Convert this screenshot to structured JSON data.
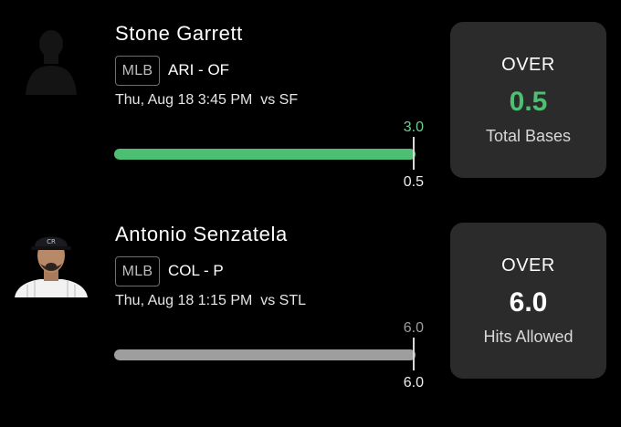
{
  "picks": [
    {
      "player_name": "Stone Garrett",
      "league": "MLB",
      "team_position": "ARI - OF",
      "game_time": "Thu, Aug 18 3:45 PM  vs SF",
      "actual_value": "3.0",
      "line_value": "0.5",
      "progress_fraction": 1.0,
      "bar_color": "#4cbf72",
      "avatar_icon": "player-silhouette-icon",
      "card": {
        "direction": "OVER",
        "value": "0.5",
        "stat": "Total Bases",
        "value_color": "#4cbf72"
      }
    },
    {
      "player_name": "Antonio Senzatela",
      "league": "MLB",
      "team_position": "COL - P",
      "game_time": "Thu, Aug 18 1:15 PM  vs STL",
      "actual_value": "6.0",
      "line_value": "6.0",
      "progress_fraction": 1.0,
      "bar_color": "#9e9e9e",
      "avatar_icon": "player-headshot-icon",
      "card": {
        "direction": "OVER",
        "value": "6.0",
        "stat": "Hits Allowed",
        "value_color": "#ffffff"
      }
    }
  ]
}
